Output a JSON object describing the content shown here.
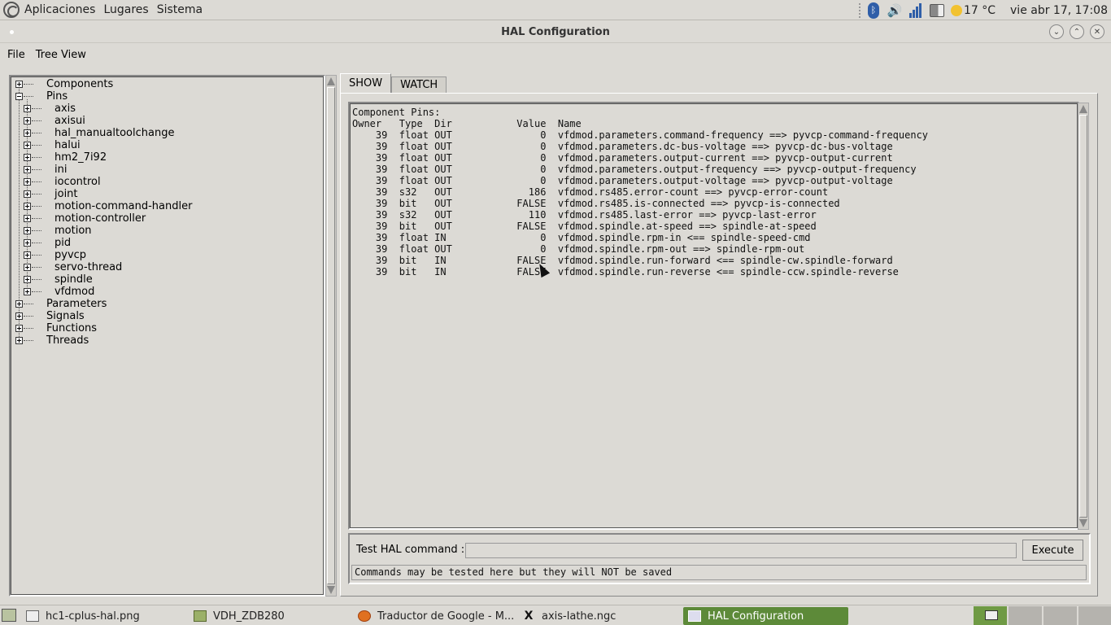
{
  "top_panel": {
    "menus": [
      "Aplicaciones",
      "Lugares",
      "Sistema"
    ],
    "temperature": "17 °C",
    "clock": "vie abr 17, 17:08",
    "bluetooth_glyph": "ᛒ"
  },
  "window": {
    "title": "HAL Configuration",
    "minimize_glyph": "⌄",
    "maximize_glyph": "⌃",
    "close_glyph": "✕"
  },
  "menubar": [
    "File",
    "Tree View"
  ],
  "tree": {
    "top": [
      "Components",
      "Pins"
    ],
    "pins_children": [
      "axis",
      "axisui",
      "hal_manualtoolchange",
      "halui",
      "hm2_7i92",
      "ini",
      "iocontrol",
      "joint",
      "motion-command-handler",
      "motion-controller",
      "motion",
      "pid",
      "pyvcp",
      "servo-thread",
      "spindle",
      "vfdmod"
    ],
    "bottom": [
      "Parameters",
      "Signals",
      "Functions",
      "Threads"
    ]
  },
  "tabs": [
    "SHOW",
    "WATCH"
  ],
  "pins": {
    "heading": "Component Pins:",
    "columns": [
      "Owner",
      "Type",
      "Dir",
      "Value",
      "Name"
    ],
    "rows": [
      [
        "39",
        "float",
        "OUT",
        "0",
        "vfdmod.parameters.command-frequency ==> pyvcp-command-frequency"
      ],
      [
        "39",
        "float",
        "OUT",
        "0",
        "vfdmod.parameters.dc-bus-voltage ==> pyvcp-dc-bus-voltage"
      ],
      [
        "39",
        "float",
        "OUT",
        "0",
        "vfdmod.parameters.output-current ==> pyvcp-output-current"
      ],
      [
        "39",
        "float",
        "OUT",
        "0",
        "vfdmod.parameters.output-frequency ==> pyvcp-output-frequency"
      ],
      [
        "39",
        "float",
        "OUT",
        "0",
        "vfdmod.parameters.output-voltage ==> pyvcp-output-voltage"
      ],
      [
        "39",
        "s32",
        "OUT",
        "186",
        "vfdmod.rs485.error-count ==> pyvcp-error-count"
      ],
      [
        "39",
        "bit",
        "OUT",
        "FALSE",
        "vfdmod.rs485.is-connected ==> pyvcp-is-connected"
      ],
      [
        "39",
        "s32",
        "OUT",
        "110",
        "vfdmod.rs485.last-error ==> pyvcp-last-error"
      ],
      [
        "39",
        "bit",
        "OUT",
        "FALSE",
        "vfdmod.spindle.at-speed ==> spindle-at-speed"
      ],
      [
        "39",
        "float",
        "IN",
        "0",
        "vfdmod.spindle.rpm-in <== spindle-speed-cmd"
      ],
      [
        "39",
        "float",
        "OUT",
        "0",
        "vfdmod.spindle.rpm-out ==> spindle-rpm-out"
      ],
      [
        "39",
        "bit",
        "IN",
        "FALSE",
        "vfdmod.spindle.run-forward <== spindle-cw.spindle-forward"
      ],
      [
        "39",
        "bit",
        "IN",
        "FALSE",
        "vfdmod.spindle.run-reverse <== spindle-ccw.spindle-reverse"
      ]
    ]
  },
  "command": {
    "label": "Test HAL command :",
    "value": "",
    "execute_label": "Execute",
    "message": "Commands may be tested here but they will NOT be saved"
  },
  "taskbar": {
    "tasks": [
      {
        "label": "hc1-cplus-hal.png",
        "icon": "image-icon"
      },
      {
        "label": "VDH_ZDB280",
        "icon": "folder-icon"
      },
      {
        "label": "Traductor de Google - M...",
        "icon": "firefox-icon"
      },
      {
        "label": "axis-lathe.ngc",
        "icon": "x-editor-icon"
      },
      {
        "label": "HAL Configuration",
        "icon": "window-icon"
      }
    ]
  }
}
